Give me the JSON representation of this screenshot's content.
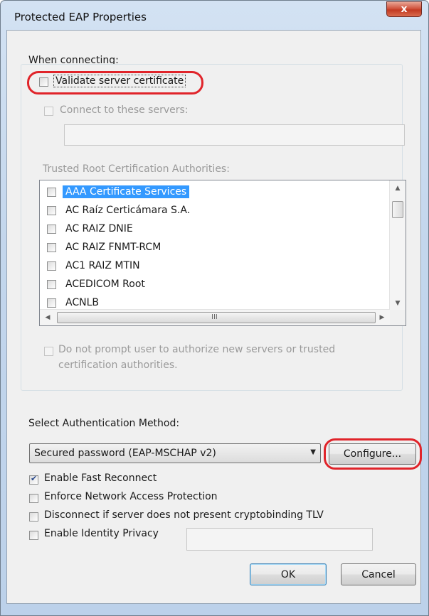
{
  "window": {
    "title": "Protected EAP Properties",
    "close_label": "x"
  },
  "connecting": {
    "heading": "When connecting:",
    "validate_cert_label": "Validate server certificate",
    "validate_cert_checked": false,
    "connect_servers_label": "Connect to these servers:",
    "connect_servers_value": "",
    "trusted_ca_label": "Trusted Root Certification Authorities:",
    "ca_list": [
      {
        "label": "AAA Certificate Services",
        "selected": true,
        "checked": false
      },
      {
        "label": "AC Raíz Certicámara S.A.",
        "selected": false,
        "checked": false
      },
      {
        "label": "AC RAIZ DNIE",
        "selected": false,
        "checked": false
      },
      {
        "label": "AC RAIZ FNMT-RCM",
        "selected": false,
        "checked": false
      },
      {
        "label": "AC1 RAIZ MTIN",
        "selected": false,
        "checked": false
      },
      {
        "label": "ACEDICOM Root",
        "selected": false,
        "checked": false
      },
      {
        "label": "ACNLB",
        "selected": false,
        "checked": false
      }
    ],
    "hscroll_grip": "III",
    "no_prompt_label_line1": "Do not prompt user to authorize new servers or trusted",
    "no_prompt_label_line2": "certification authorities."
  },
  "auth": {
    "heading": "Select Authentication Method:",
    "method_value": "Secured password (EAP-MSCHAP v2)",
    "configure_label": "Configure...",
    "options": [
      {
        "label": "Enable Fast Reconnect",
        "checked": true
      },
      {
        "label": "Enforce Network Access Protection",
        "checked": false
      },
      {
        "label": "Disconnect if server does not present cryptobinding TLV",
        "checked": false
      },
      {
        "label": "Enable Identity Privacy",
        "checked": false
      }
    ],
    "identity_value": ""
  },
  "footer": {
    "ok_label": "OK",
    "cancel_label": "Cancel"
  },
  "colors": {
    "highlight_ring": "#e0242a",
    "selection": "#3399ff"
  }
}
